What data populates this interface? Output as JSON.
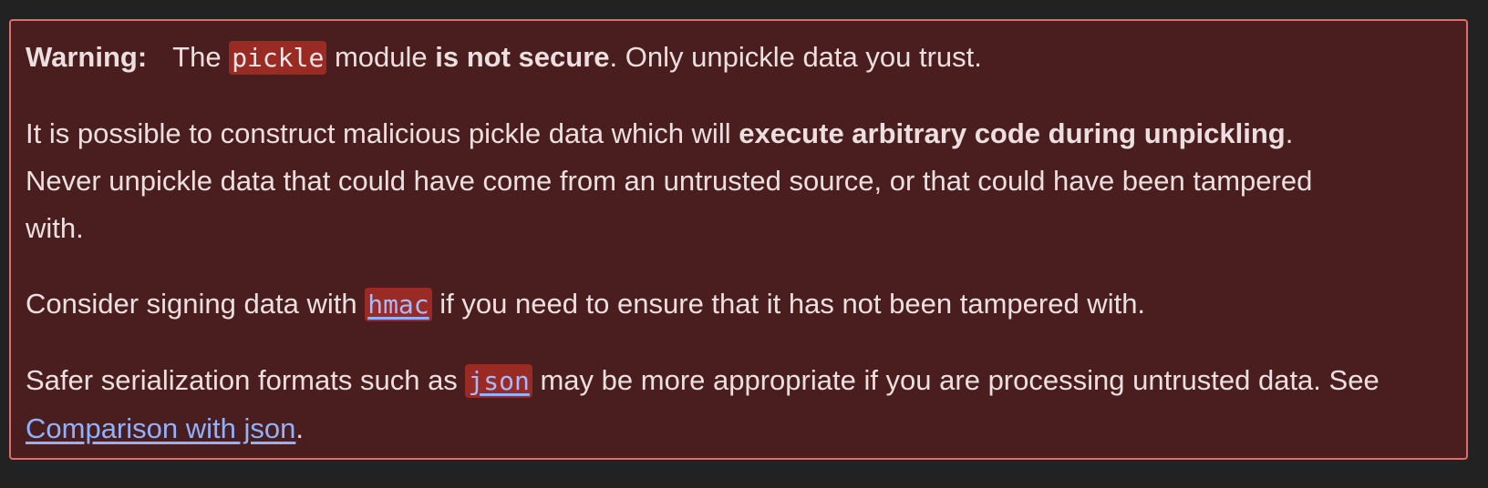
{
  "warning": {
    "label": "Warning:",
    "p1": {
      "t1": "The ",
      "code_pickle": "pickle",
      "t2": " module ",
      "bold": "is not secure",
      "t3": ". Only unpickle data you trust."
    },
    "p2": {
      "t1": "It is possible to construct malicious pickle data which will ",
      "bold": "execute arbitrary code during unpickling",
      "t2": ".",
      "line2": "Never unpickle data that could have come from an untrusted source, or that could have been tampered",
      "line3": "with."
    },
    "p3": {
      "t1": "Consider signing data with ",
      "link_hmac": "hmac",
      "t2": " if you need to ensure that it has not been tampered with."
    },
    "p4": {
      "t1": "Safer serialization formats such as ",
      "link_json": "json",
      "t2": " may be more appropriate if you are processing untrusted data. See",
      "link_comparison": "Comparison with json",
      "t3": "."
    }
  },
  "colors": {
    "page_bg": "#222222",
    "box_bg": "#4a1e1e",
    "box_border": "#e06c6c",
    "code_bg": "#9a2a24",
    "link": "#8fb1ff"
  }
}
